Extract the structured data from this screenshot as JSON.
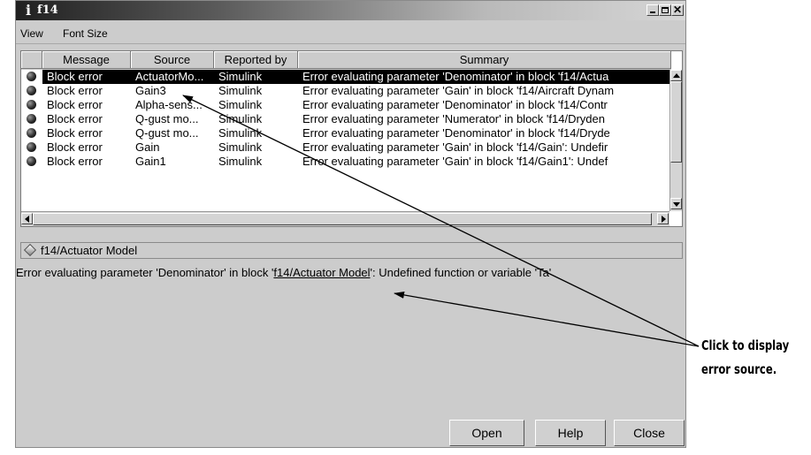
{
  "window": {
    "title": "f14",
    "title_icon": "i",
    "controls": [
      "minimize",
      "maximize",
      "close"
    ]
  },
  "menu": {
    "items": [
      "View",
      "Font Size"
    ]
  },
  "table": {
    "columns": [
      "Message",
      "Source",
      "Reported by",
      "Summary"
    ],
    "rows": [
      {
        "message": "Block error",
        "source": "ActuatorMo...",
        "reported_by": "Simulink",
        "summary": "Error evaluating parameter 'Denominator' in block 'f14/Actua",
        "selected": true
      },
      {
        "message": "Block error",
        "source": "Gain3",
        "reported_by": "Simulink",
        "summary": "Error evaluating parameter 'Gain' in block 'f14/Aircraft Dynam",
        "selected": false
      },
      {
        "message": "Block error",
        "source": "Alpha-sens...",
        "reported_by": "Simulink",
        "summary": "Error evaluating parameter 'Denominator' in block 'f14/Contr",
        "selected": false
      },
      {
        "message": "Block error",
        "source": "Q-gust mo...",
        "reported_by": "Simulink",
        "summary": "Error evaluating parameter 'Numerator' in block 'f14/Dryden",
        "selected": false
      },
      {
        "message": "Block error",
        "source": "Q-gust mo...",
        "reported_by": "Simulink",
        "summary": "Error evaluating parameter 'Denominator' in block 'f14/Dryde",
        "selected": false
      },
      {
        "message": "Block error",
        "source": "Gain",
        "reported_by": "Simulink",
        "summary": "Error evaluating parameter 'Gain' in block 'f14/Gain': Undefir",
        "selected": false
      },
      {
        "message": "Block error",
        "source": "Gain1",
        "reported_by": "Simulink",
        "summary": "Error evaluating parameter 'Gain' in block 'f14/Gain1': Undef",
        "selected": false
      }
    ]
  },
  "detail": {
    "path": "f14/Actuator Model",
    "message_prefix": "Error evaluating parameter 'Denominator' in block '",
    "link_text": "f14/Actuator Model",
    "message_suffix": "': Undefined function or variable 'Ta'"
  },
  "buttons": {
    "open": "Open",
    "help": "Help",
    "close": "Close"
  },
  "callout": {
    "line1": "Click to display",
    "line2": "error source."
  }
}
